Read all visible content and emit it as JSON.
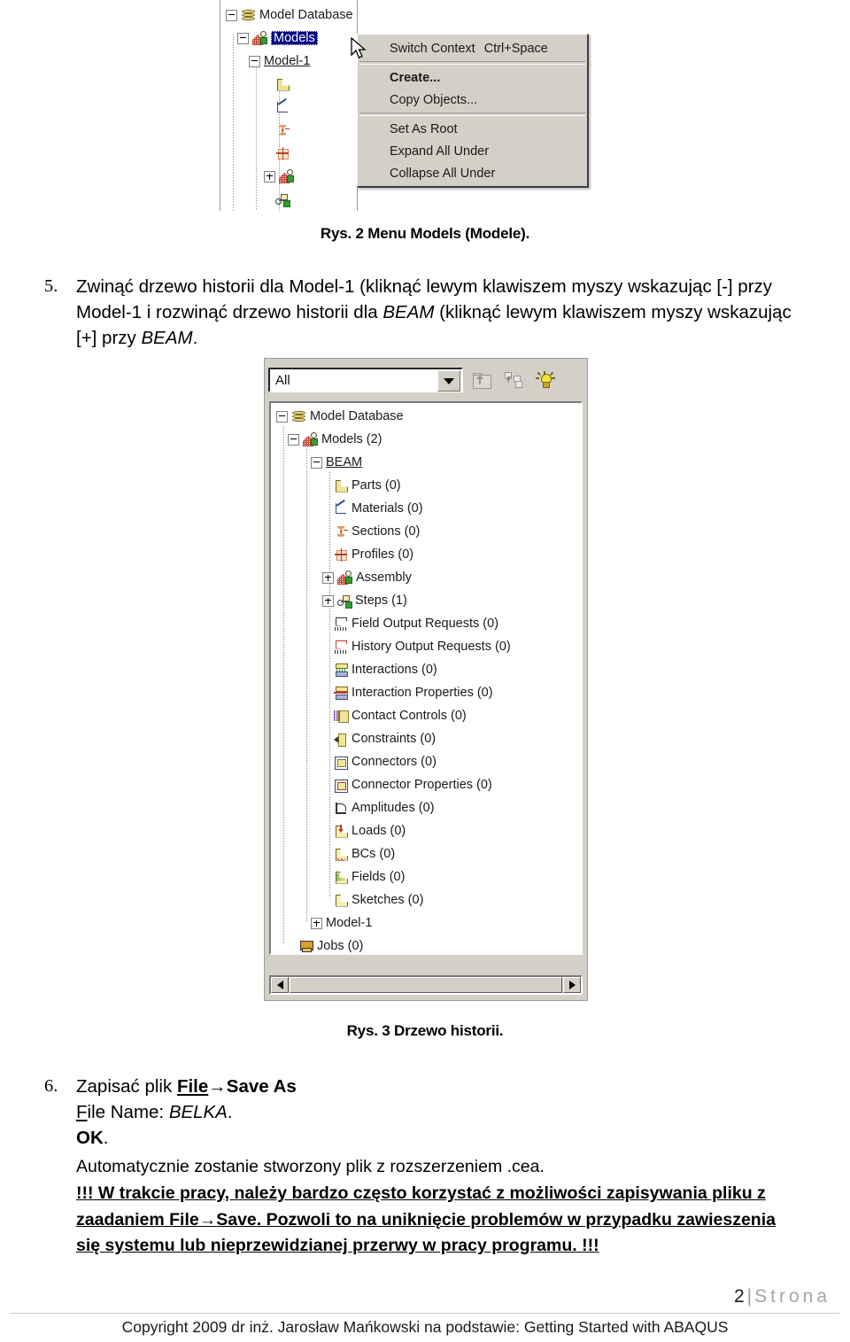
{
  "figure2": {
    "tree_rows": [
      {
        "label": "Model Database",
        "indent": 0,
        "expander": "minus",
        "icon": "database-icon"
      },
      {
        "label": "Models",
        "indent": 1,
        "expander": "minus",
        "icon": "models-icon",
        "selected": true
      },
      {
        "label": "Model-1",
        "indent": 2,
        "expander": "minus",
        "icon": "none"
      },
      {
        "label": "",
        "indent": 3,
        "expander": "none",
        "icon": "parts-icon"
      },
      {
        "label": "",
        "indent": 3,
        "expander": "none",
        "icon": "materials-icon"
      },
      {
        "label": "",
        "indent": 3,
        "expander": "none",
        "icon": "sections-icon"
      },
      {
        "label": "",
        "indent": 3,
        "expander": "none",
        "icon": "profiles-icon"
      },
      {
        "label": "",
        "indent": 3,
        "expander": "plus",
        "icon": "assembly-icon"
      },
      {
        "label": "",
        "indent": 3,
        "expander": "none",
        "icon": "steps-icon"
      }
    ],
    "context_menu": {
      "items": [
        {
          "label": "Switch Context",
          "accel": "Ctrl+Space",
          "bold": false
        },
        {
          "separator": true
        },
        {
          "label": "Create...",
          "accel": "",
          "bold": true
        },
        {
          "label": "Copy Objects...",
          "accel": "",
          "bold": false
        },
        {
          "separator": true
        },
        {
          "label": "Set As Root",
          "accel": "",
          "bold": false
        },
        {
          "label": "Expand All Under",
          "accel": "",
          "bold": false
        },
        {
          "label": "Collapse All Under",
          "accel": "",
          "bold": false
        }
      ]
    },
    "caption": "Rys. 2 Menu Models (Modele)."
  },
  "step5": {
    "number": "5.",
    "line1_a": "Zwinąć drzewo historii dla Model-1 (kliknąć lewym klawiszem myszy wskazując [-] przy",
    "line2_a": "Model-1 i rozwinąć drzewo historii dla ",
    "line2_em": "BEAM",
    "line2_b": " (kliknąć lewym klawiszem myszy wskazując",
    "line3_a": "[+] przy ",
    "line3_em": "BEAM",
    "line3_b": "."
  },
  "figure3": {
    "toolbar": {
      "combo_value": "All",
      "combo_placeholder": "All",
      "buttons": [
        "folder-up-icon",
        "pick-objects-icon",
        "light-bulb-icon"
      ]
    },
    "tree_rows": [
      {
        "label": "Model Database",
        "indent": 0,
        "expander": "minus",
        "icon": "database-icon"
      },
      {
        "label": "Models (2)",
        "indent": 1,
        "expander": "minus",
        "icon": "models-icon"
      },
      {
        "label": "BEAM",
        "indent": 2,
        "expander": "minus",
        "icon": "none",
        "underline": true
      },
      {
        "label": "Parts (0)",
        "indent": 3,
        "expander": "none",
        "icon": "parts-icon"
      },
      {
        "label": "Materials (0)",
        "indent": 3,
        "expander": "none",
        "icon": "materials-icon"
      },
      {
        "label": "Sections (0)",
        "indent": 3,
        "expander": "none",
        "icon": "sections-icon"
      },
      {
        "label": "Profiles (0)",
        "indent": 3,
        "expander": "none",
        "icon": "profiles-icon"
      },
      {
        "label": "Assembly",
        "indent": 3,
        "expander": "plus",
        "icon": "assembly-icon"
      },
      {
        "label": "Steps (1)",
        "indent": 3,
        "expander": "plus",
        "icon": "steps-icon"
      },
      {
        "label": "Field Output Requests (0)",
        "indent": 3,
        "expander": "none",
        "icon": "field-output-icon"
      },
      {
        "label": "History Output Requests (0)",
        "indent": 3,
        "expander": "none",
        "icon": "history-output-icon"
      },
      {
        "label": "Interactions (0)",
        "indent": 3,
        "expander": "none",
        "icon": "interactions-icon"
      },
      {
        "label": "Interaction Properties (0)",
        "indent": 3,
        "expander": "none",
        "icon": "interaction-properties-icon"
      },
      {
        "label": "Contact Controls (0)",
        "indent": 3,
        "expander": "none",
        "icon": "contact-controls-icon"
      },
      {
        "label": "Constraints (0)",
        "indent": 3,
        "expander": "none",
        "icon": "constraints-icon"
      },
      {
        "label": "Connectors (0)",
        "indent": 3,
        "expander": "none",
        "icon": "connectors-icon"
      },
      {
        "label": "Connector Properties (0)",
        "indent": 3,
        "expander": "none",
        "icon": "connector-properties-icon"
      },
      {
        "label": "Amplitudes (0)",
        "indent": 3,
        "expander": "none",
        "icon": "amplitudes-icon"
      },
      {
        "label": "Loads (0)",
        "indent": 3,
        "expander": "none",
        "icon": "loads-icon"
      },
      {
        "label": "BCs (0)",
        "indent": 3,
        "expander": "none",
        "icon": "bcs-icon"
      },
      {
        "label": "Fields (0)",
        "indent": 3,
        "expander": "none",
        "icon": "fields-icon"
      },
      {
        "label": "Sketches (0)",
        "indent": 3,
        "expander": "none",
        "icon": "sketches-icon"
      },
      {
        "label": "Model-1",
        "indent": 2,
        "expander": "plus",
        "icon": "none"
      },
      {
        "label": "Jobs (0)",
        "indent": 1,
        "expander": "none",
        "icon": "jobs-icon"
      }
    ],
    "caption": "Rys. 3 Drzewo historii."
  },
  "step6": {
    "number": "6.",
    "line1_a": "Zapisać plik ",
    "line1_file": "File",
    "line1_arrow": "→",
    "line1_saveas": "Save As",
    "line2_a": "ile Name: ",
    "line2_f": "F",
    "line2_em": "BELKA",
    "line2_b": ".",
    "line3_ok": "OK",
    "line3_b": "."
  },
  "auto_paragraph": "Automatycznie zostanie stworzony plik z rozszerzeniem .cea.",
  "warning": {
    "l1": "!!! W trakcie pracy, należy bardzo często korzystać z możliwości zapisywania pliku z",
    "l2_a": "zaadaniem ",
    "l2_file": "File",
    "l2_arrow": "→",
    "l2_save": "Save",
    "l2_b": ". Pozwoli to na uniknięcie problemów w przypadku zawieszenia",
    "l3": "się systemu lub nieprzewidzianej przerwy w pracy programu. !!!"
  },
  "footer": {
    "page_number": "2",
    "separator": "|",
    "page_word": "Strona",
    "copyright": "Copyright 2009 dr inż. Jarosław Mańkowski na podstawie: Getting Started with ABAQUS"
  }
}
